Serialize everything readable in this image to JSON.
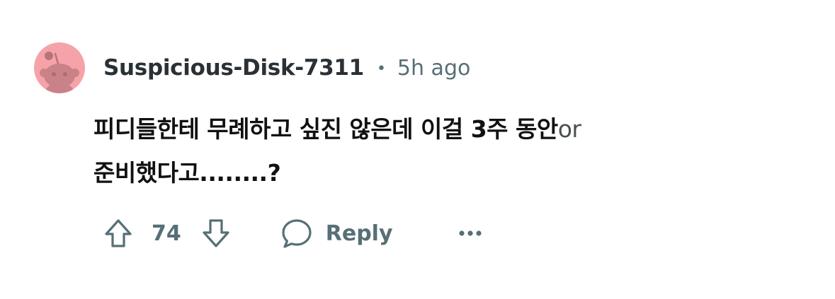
{
  "comment": {
    "author": "Suspicious-Disk-7311",
    "separator": "•",
    "timestamp": "5h ago",
    "body_line1": "피디들한테 무례하고 싶진 않은데 이걸 3주 동안",
    "body_line1_trailing": "or",
    "body_line2": "준비했다고........?",
    "score": "74",
    "reply_label": "Reply"
  },
  "icons": {
    "avatar": "reddit-snoo-avatar-icon",
    "upvote": "arrow-up-icon",
    "downvote": "arrow-down-icon",
    "reply": "speech-bubble-icon",
    "more": "ellipsis-icon"
  },
  "colors": {
    "avatar_bg": "#f5a3a8",
    "avatar_fg": "#c98287",
    "meta_gray": "#576f76",
    "author": "#2a3136",
    "body_text": "#111111"
  }
}
